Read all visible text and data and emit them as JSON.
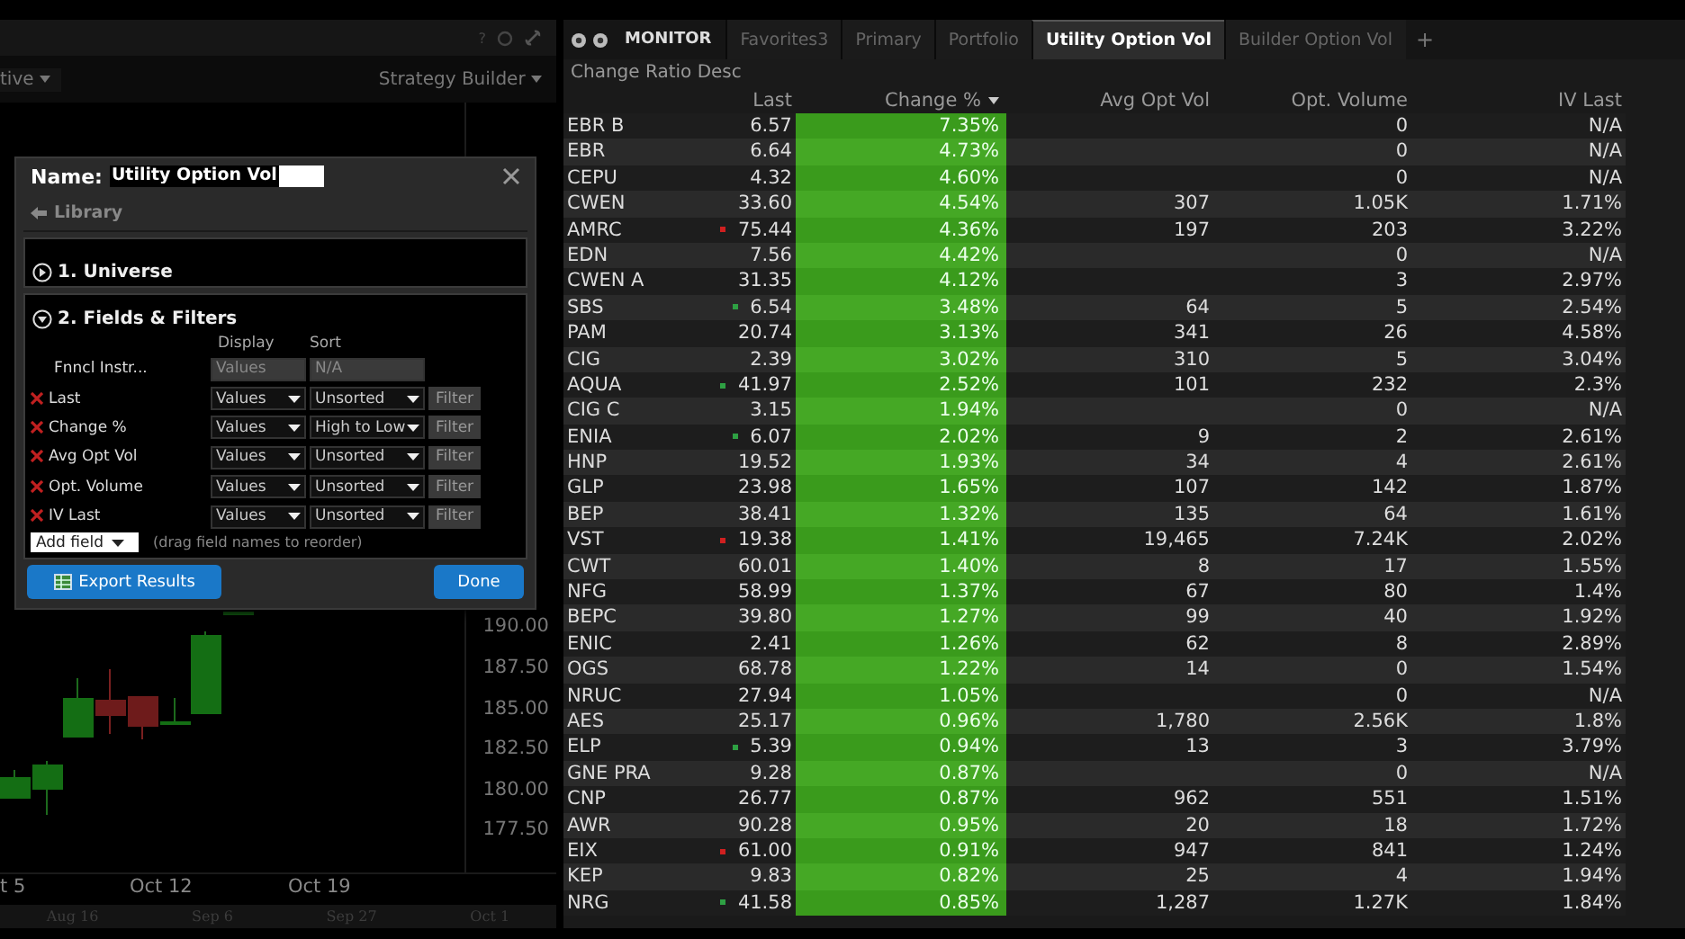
{
  "left_panel": {
    "help": "?",
    "mode_dropdown": "tive",
    "strategy_dropdown": "Strategy Builder",
    "chart": {
      "price_labels": [
        "190.00",
        "187.50",
        "185.00",
        "182.50",
        "180.00",
        "177.50"
      ],
      "date_labels": [
        "t 5",
        "Oct 12",
        "Oct 19"
      ],
      "navigator_labels": [
        "Aug 16",
        "Sep 6",
        "Sep 27",
        "Oct 1"
      ]
    }
  },
  "dialog": {
    "name_label": "Name:",
    "name_value": "Utility Option Vol",
    "library": "Library",
    "sections": [
      {
        "title": "1. Universe",
        "expanded": false
      },
      {
        "title": "2. Fields & Filters",
        "expanded": true
      }
    ],
    "field_headers": [
      "Display",
      "Sort"
    ],
    "fields": [
      {
        "name": "Fnncl Instr...",
        "display": "Values",
        "sort": "N/A",
        "removable": false
      },
      {
        "name": "Last",
        "display": "Values",
        "sort": "Unsorted",
        "removable": true,
        "filter": "Filter"
      },
      {
        "name": "Change %",
        "display": "Values",
        "sort": "High to Low",
        "removable": true,
        "filter": "Filter"
      },
      {
        "name": "Avg Opt Vol",
        "display": "Values",
        "sort": "Unsorted",
        "removable": true,
        "filter": "Filter"
      },
      {
        "name": "Opt. Volume",
        "display": "Values",
        "sort": "Unsorted",
        "removable": true,
        "filter": "Filter"
      },
      {
        "name": "IV Last",
        "display": "Values",
        "sort": "Unsorted",
        "removable": true,
        "filter": "Filter"
      }
    ],
    "add_field": "Add field",
    "hint": "(drag field names to reorder)",
    "buttons": {
      "export": "Export Results",
      "done": "Done"
    }
  },
  "monitor": {
    "label": "MONITOR",
    "tabs": [
      {
        "label": "Favorites3",
        "selected": false
      },
      {
        "label": "Primary",
        "selected": false
      },
      {
        "label": "Portfolio",
        "selected": false
      },
      {
        "label": "Utility Option Vol",
        "selected": true
      },
      {
        "label": "Builder Option Vol",
        "selected": false
      }
    ],
    "add_tab": "+",
    "subtitle": "Change Ratio Desc",
    "table": {
      "columns": [
        {
          "label": "Last",
          "sorted": false
        },
        {
          "label": "Change %",
          "sorted": true
        },
        {
          "label": "Avg Opt Vol",
          "sorted": false
        },
        {
          "label": "Opt. Volume",
          "sorted": false
        },
        {
          "label": "IV Last",
          "sorted": false
        }
      ],
      "rows": [
        {
          "symbol": "EBR B",
          "cells": [
            "6.57",
            "7.35%",
            null,
            "0",
            "N/A"
          ]
        },
        {
          "symbol": "EBR",
          "cells": [
            "6.64",
            "4.73%",
            null,
            "0",
            "N/A"
          ]
        },
        {
          "symbol": "CEPU",
          "cells": [
            "4.32",
            "4.60%",
            null,
            "0",
            "N/A"
          ]
        },
        {
          "symbol": "CWEN",
          "cells": [
            "33.60",
            "4.54%",
            "307",
            "1.05K",
            "1.71%"
          ]
        },
        {
          "symbol": "AMRC",
          "cells": [
            "75.44",
            "4.36%",
            "197",
            "203",
            "3.22%"
          ],
          "color": "#d02020"
        },
        {
          "symbol": "EDN",
          "cells": [
            "7.56",
            "4.42%",
            null,
            "0",
            "N/A"
          ]
        },
        {
          "symbol": "CWEN A",
          "cells": [
            "31.35",
            "4.12%",
            null,
            "3",
            "2.97%"
          ]
        },
        {
          "symbol": "SBS",
          "cells": [
            "6.54",
            "3.48%",
            "64",
            "5",
            "2.54%"
          ],
          "color": "#2ea043"
        },
        {
          "symbol": "PAM",
          "cells": [
            "20.74",
            "3.13%",
            "341",
            "26",
            "4.58%"
          ]
        },
        {
          "symbol": "CIG",
          "cells": [
            "2.39",
            "3.02%",
            "310",
            "5",
            "3.04%"
          ]
        },
        {
          "symbol": "AQUA",
          "cells": [
            "41.97",
            "2.52%",
            "101",
            "232",
            "2.3%"
          ],
          "color": "#2ea043"
        },
        {
          "symbol": "CIG C",
          "cells": [
            "3.15",
            "1.94%",
            null,
            "0",
            "N/A"
          ]
        },
        {
          "symbol": "ENIA",
          "cells": [
            "6.07",
            "2.02%",
            "9",
            "2",
            "2.61%"
          ],
          "color": "#2ea043"
        },
        {
          "symbol": "HNP",
          "cells": [
            "19.52",
            "1.93%",
            "34",
            "4",
            "2.61%"
          ]
        },
        {
          "symbol": "GLP",
          "cells": [
            "23.98",
            "1.65%",
            "107",
            "142",
            "1.87%"
          ]
        },
        {
          "symbol": "BEP",
          "cells": [
            "38.41",
            "1.32%",
            "135",
            "64",
            "1.61%"
          ]
        },
        {
          "symbol": "VST",
          "cells": [
            "19.38",
            "1.41%",
            "19,465",
            "7.24K",
            "2.02%"
          ],
          "color": "#d02020"
        },
        {
          "symbol": "CWT",
          "cells": [
            "60.01",
            "1.40%",
            "8",
            "17",
            "1.55%"
          ]
        },
        {
          "symbol": "NFG",
          "cells": [
            "58.99",
            "1.37%",
            "67",
            "80",
            "1.4%"
          ]
        },
        {
          "symbol": "BEPC",
          "cells": [
            "39.80",
            "1.27%",
            "99",
            "40",
            "1.92%"
          ]
        },
        {
          "symbol": "ENIC",
          "cells": [
            "2.41",
            "1.26%",
            "62",
            "8",
            "2.89%"
          ]
        },
        {
          "symbol": "OGS",
          "cells": [
            "68.78",
            "1.22%",
            "14",
            "0",
            "1.54%"
          ]
        },
        {
          "symbol": "NRUC",
          "cells": [
            "27.94",
            "1.05%",
            null,
            "0",
            "N/A"
          ]
        },
        {
          "symbol": "AES",
          "cells": [
            "25.17",
            "0.96%",
            "1,780",
            "2.56K",
            "1.8%"
          ]
        },
        {
          "symbol": "ELP",
          "cells": [
            "5.39",
            "0.94%",
            "13",
            "3",
            "3.79%"
          ],
          "color": "#2ea043"
        },
        {
          "symbol": "GNE PRA",
          "cells": [
            "9.28",
            "0.87%",
            null,
            "0",
            "N/A"
          ]
        },
        {
          "symbol": "CNP",
          "cells": [
            "26.77",
            "0.87%",
            "962",
            "551",
            "1.51%"
          ]
        },
        {
          "symbol": "AWR",
          "cells": [
            "90.28",
            "0.95%",
            "20",
            "18",
            "1.72%"
          ]
        },
        {
          "symbol": "EIX",
          "cells": [
            "61.00",
            "0.91%",
            "947",
            "841",
            "1.24%"
          ],
          "color": "#d02020"
        },
        {
          "symbol": "KEP",
          "cells": [
            "9.83",
            "0.82%",
            "25",
            "4",
            "1.94%"
          ]
        },
        {
          "symbol": "NRG",
          "cells": [
            "41.58",
            "0.85%",
            "1,287",
            "1.27K",
            "1.84%"
          ],
          "color": "#2ea043"
        }
      ]
    }
  }
}
